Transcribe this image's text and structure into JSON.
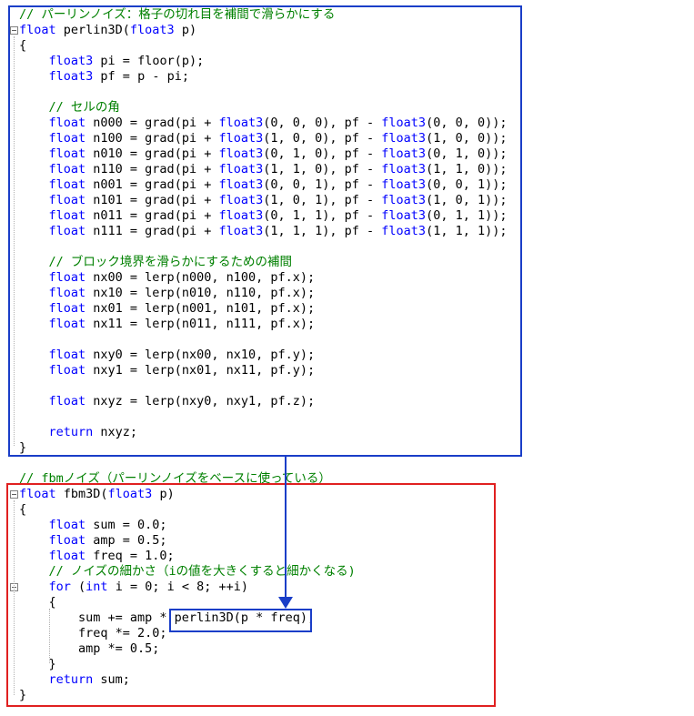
{
  "colors": {
    "comment": "#008000",
    "keyword": "#0000ff",
    "text": "#000000",
    "perlin_box": "#1a3ec8",
    "fbm_box": "#e02020",
    "call_box": "#1a3ec8",
    "arrow": "#1a3ec8"
  },
  "icons": {
    "fold_marker": "collapse-minus-icon"
  },
  "perlin": {
    "lines": [
      [
        [
          "cm",
          "// パーリンノイズ：格子の切れ目を補間で滑らかにする"
        ]
      ],
      [
        [
          "kw",
          "float"
        ],
        [
          "tx",
          " perlin3D("
        ],
        [
          "kw",
          "float3"
        ],
        [
          "tx",
          " p)"
        ]
      ],
      [
        [
          "tx",
          "{"
        ]
      ],
      [
        [
          "tx",
          "    "
        ],
        [
          "kw",
          "float3"
        ],
        [
          "tx",
          " pi = floor(p);"
        ]
      ],
      [
        [
          "tx",
          "    "
        ],
        [
          "kw",
          "float3"
        ],
        [
          "tx",
          " pf = p - pi;"
        ]
      ],
      [],
      [
        [
          "tx",
          "    "
        ],
        [
          "cm",
          "// セルの角"
        ]
      ],
      [
        [
          "tx",
          "    "
        ],
        [
          "kw",
          "float"
        ],
        [
          "tx",
          " n000 = grad(pi + "
        ],
        [
          "kw",
          "float3"
        ],
        [
          "tx",
          "(0, 0, 0), pf - "
        ],
        [
          "kw",
          "float3"
        ],
        [
          "tx",
          "(0, 0, 0));"
        ]
      ],
      [
        [
          "tx",
          "    "
        ],
        [
          "kw",
          "float"
        ],
        [
          "tx",
          " n100 = grad(pi + "
        ],
        [
          "kw",
          "float3"
        ],
        [
          "tx",
          "(1, 0, 0), pf - "
        ],
        [
          "kw",
          "float3"
        ],
        [
          "tx",
          "(1, 0, 0));"
        ]
      ],
      [
        [
          "tx",
          "    "
        ],
        [
          "kw",
          "float"
        ],
        [
          "tx",
          " n010 = grad(pi + "
        ],
        [
          "kw",
          "float3"
        ],
        [
          "tx",
          "(0, 1, 0), pf - "
        ],
        [
          "kw",
          "float3"
        ],
        [
          "tx",
          "(0, 1, 0));"
        ]
      ],
      [
        [
          "tx",
          "    "
        ],
        [
          "kw",
          "float"
        ],
        [
          "tx",
          " n110 = grad(pi + "
        ],
        [
          "kw",
          "float3"
        ],
        [
          "tx",
          "(1, 1, 0), pf - "
        ],
        [
          "kw",
          "float3"
        ],
        [
          "tx",
          "(1, 1, 0));"
        ]
      ],
      [
        [
          "tx",
          "    "
        ],
        [
          "kw",
          "float"
        ],
        [
          "tx",
          " n001 = grad(pi + "
        ],
        [
          "kw",
          "float3"
        ],
        [
          "tx",
          "(0, 0, 1), pf - "
        ],
        [
          "kw",
          "float3"
        ],
        [
          "tx",
          "(0, 0, 1));"
        ]
      ],
      [
        [
          "tx",
          "    "
        ],
        [
          "kw",
          "float"
        ],
        [
          "tx",
          " n101 = grad(pi + "
        ],
        [
          "kw",
          "float3"
        ],
        [
          "tx",
          "(1, 0, 1), pf - "
        ],
        [
          "kw",
          "float3"
        ],
        [
          "tx",
          "(1, 0, 1));"
        ]
      ],
      [
        [
          "tx",
          "    "
        ],
        [
          "kw",
          "float"
        ],
        [
          "tx",
          " n011 = grad(pi + "
        ],
        [
          "kw",
          "float3"
        ],
        [
          "tx",
          "(0, 1, 1), pf - "
        ],
        [
          "kw",
          "float3"
        ],
        [
          "tx",
          "(0, 1, 1));"
        ]
      ],
      [
        [
          "tx",
          "    "
        ],
        [
          "kw",
          "float"
        ],
        [
          "tx",
          " n111 = grad(pi + "
        ],
        [
          "kw",
          "float3"
        ],
        [
          "tx",
          "(1, 1, 1), pf - "
        ],
        [
          "kw",
          "float3"
        ],
        [
          "tx",
          "(1, 1, 1));"
        ]
      ],
      [],
      [
        [
          "tx",
          "    "
        ],
        [
          "cm",
          "// ブロック境界を滑らかにするための補間"
        ]
      ],
      [
        [
          "tx",
          "    "
        ],
        [
          "kw",
          "float"
        ],
        [
          "tx",
          " nx00 = lerp(n000, n100, pf.x);"
        ]
      ],
      [
        [
          "tx",
          "    "
        ],
        [
          "kw",
          "float"
        ],
        [
          "tx",
          " nx10 = lerp(n010, n110, pf.x);"
        ]
      ],
      [
        [
          "tx",
          "    "
        ],
        [
          "kw",
          "float"
        ],
        [
          "tx",
          " nx01 = lerp(n001, n101, pf.x);"
        ]
      ],
      [
        [
          "tx",
          "    "
        ],
        [
          "kw",
          "float"
        ],
        [
          "tx",
          " nx11 = lerp(n011, n111, pf.x);"
        ]
      ],
      [],
      [
        [
          "tx",
          "    "
        ],
        [
          "kw",
          "float"
        ],
        [
          "tx",
          " nxy0 = lerp(nx00, nx10, pf.y);"
        ]
      ],
      [
        [
          "tx",
          "    "
        ],
        [
          "kw",
          "float"
        ],
        [
          "tx",
          " nxy1 = lerp(nx01, nx11, pf.y);"
        ]
      ],
      [],
      [
        [
          "tx",
          "    "
        ],
        [
          "kw",
          "float"
        ],
        [
          "tx",
          " nxyz = lerp(nxy0, nxy1, pf.z);"
        ]
      ],
      [],
      [
        [
          "tx",
          "    "
        ],
        [
          "kw",
          "return"
        ],
        [
          "tx",
          " nxyz;"
        ]
      ],
      [
        [
          "tx",
          "}"
        ]
      ]
    ]
  },
  "fbm": {
    "lines": [
      [
        [
          "cm",
          "// fbmノイズ（パーリンノイズをベースに使っている）"
        ]
      ],
      [
        [
          "kw",
          "float"
        ],
        [
          "tx",
          " fbm3D("
        ],
        [
          "kw",
          "float3"
        ],
        [
          "tx",
          " p)"
        ]
      ],
      [
        [
          "tx",
          "{"
        ]
      ],
      [
        [
          "tx",
          "    "
        ],
        [
          "kw",
          "float"
        ],
        [
          "tx",
          " sum = 0.0;"
        ]
      ],
      [
        [
          "tx",
          "    "
        ],
        [
          "kw",
          "float"
        ],
        [
          "tx",
          " amp = 0.5;"
        ]
      ],
      [
        [
          "tx",
          "    "
        ],
        [
          "kw",
          "float"
        ],
        [
          "tx",
          " freq = 1.0;"
        ]
      ],
      [
        [
          "tx",
          "    "
        ],
        [
          "cm",
          "// ノイズの細かさ（iの値を大きくすると細かくなる)"
        ]
      ],
      [
        [
          "tx",
          "    "
        ],
        [
          "kw",
          "for"
        ],
        [
          "tx",
          " ("
        ],
        [
          "kw",
          "int"
        ],
        [
          "tx",
          " i = 0; i < 8; ++i)"
        ]
      ],
      [
        [
          "tx",
          "    {"
        ]
      ],
      [
        [
          "tx",
          "        sum += amp * perlin3D(p * freq);"
        ]
      ],
      [
        [
          "tx",
          "        freq *= 2.0;"
        ]
      ],
      [
        [
          "tx",
          "        amp *= 0.5;"
        ]
      ],
      [
        [
          "tx",
          "    }"
        ]
      ],
      [
        [
          "tx",
          "    "
        ],
        [
          "kw",
          "return"
        ],
        [
          "tx",
          " sum;"
        ]
      ],
      [
        [
          "tx",
          "}"
        ]
      ]
    ]
  }
}
